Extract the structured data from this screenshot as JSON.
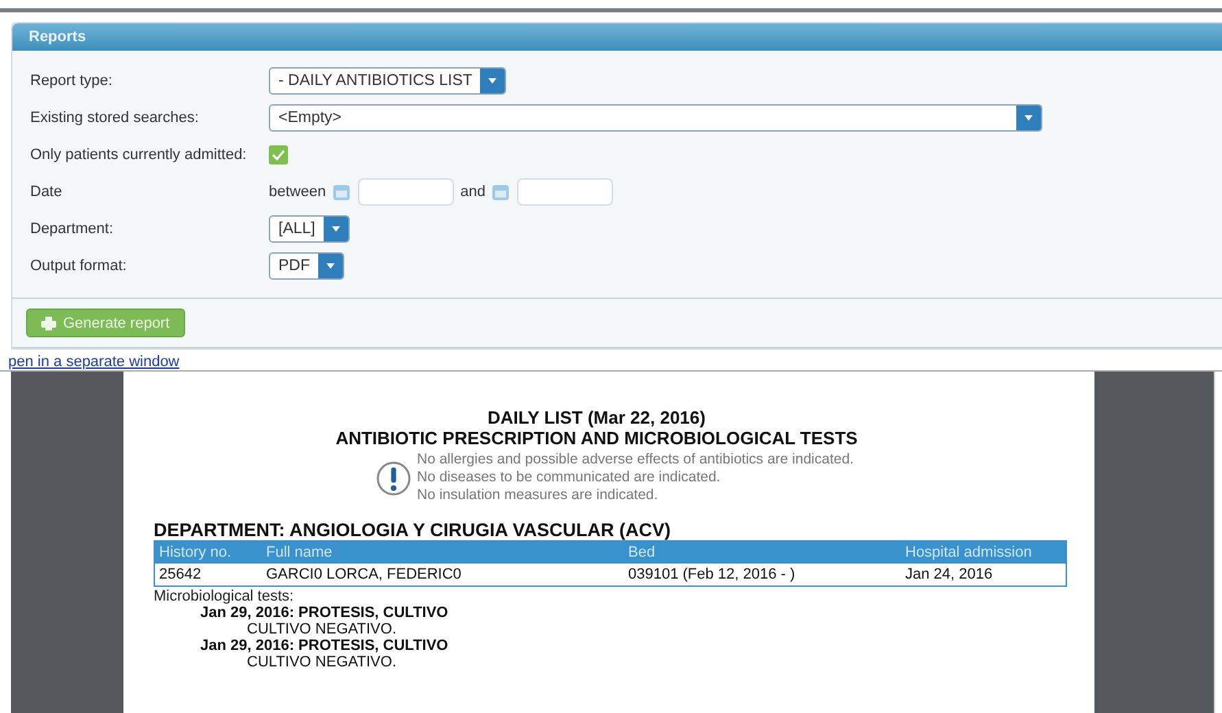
{
  "panel": {
    "title": "Reports"
  },
  "fields": [
    {
      "kind": "select",
      "label": "Report type:",
      "value": "- DAILY ANTIBIOTICS LIST"
    },
    {
      "kind": "long-select",
      "label": "Existing stored searches:",
      "value": "<Empty>"
    },
    {
      "kind": "checkbox",
      "label": "Only patients currently admitted:",
      "checked": true
    },
    {
      "kind": "date-range",
      "label": "Date",
      "from_label": "between",
      "to_label": "and"
    },
    {
      "kind": "select",
      "label": "Department:",
      "value": "[ALL]"
    },
    {
      "kind": "select",
      "label": "Output format:",
      "value": "PDF"
    }
  ],
  "generate_button": "Generate report",
  "link": "pen in a separate window",
  "document": {
    "title_lines": [
      "DAILY LIST (Mar 22, 2016)",
      "ANTIBIOTIC PRESCRIPTION AND MICROBIOLOGICAL TESTS"
    ],
    "notices": [
      "No allergies and possible adverse effects of antibiotics are indicated.",
      "No diseases to be communicated are indicated.",
      "No insulation measures are indicated."
    ],
    "department": "DEPARTMENT: ANGIOLOGIA Y CIRUGIA VASCULAR (ACV)",
    "table": {
      "columns": [
        "History no.",
        "Full name",
        "Bed",
        "Hospital admission"
      ],
      "rows": [
        [
          "25642",
          "GARCI0 LORCA, FEDERIC0",
          "039101 (Feb 12, 2016 - )",
          "Jan 24, 2016"
        ]
      ]
    },
    "tests_label": "Microbiological tests:",
    "tests": [
      {
        "heading": "Jan 29, 2016: PROTESIS, CULTIVO",
        "result": "CULTIVO NEGATIVO."
      },
      {
        "heading": "Jan 29, 2016: PROTESIS, CULTIVO",
        "result": "CULTIVO NEGATIVO."
      }
    ]
  }
}
